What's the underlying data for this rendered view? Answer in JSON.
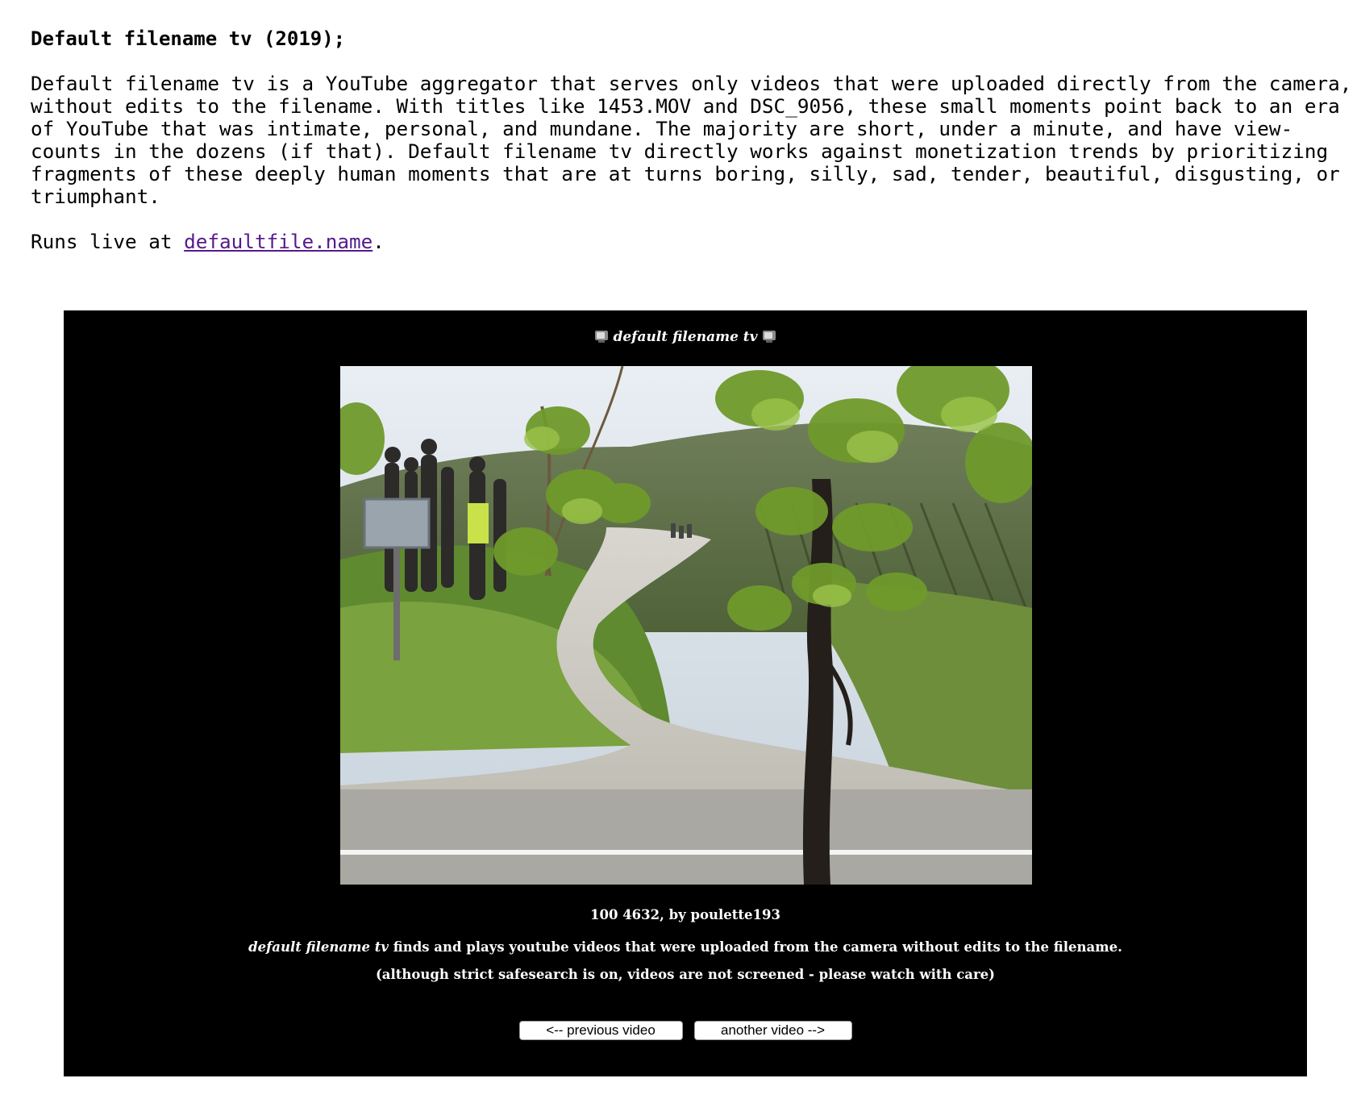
{
  "article": {
    "heading": "Default filename tv (2019);",
    "description_lines": [
      "Default filename tv is a YouTube aggregator that serves only videos that were uploaded directly from the camera,",
      "without edits to the filename. With titles like 1453.MOV and DSC_9056, these small moments point back to an era",
      "of YouTube that was intimate, personal, and mundane. The majority are short, under a minute, and have view-",
      "counts in the dozens (if that). Default filename tv directly works against monetization trends by prioritizing",
      "fragments of these deeply human moments that are at turns boring, silly, sad, tender, beautiful, disgusting, or",
      "triumphant."
    ],
    "runs_prefix": "Runs live at ",
    "runs_link_text": "defaultfile.name",
    "runs_suffix": "."
  },
  "embed": {
    "title": "default filename tv",
    "title_icon": "tv-icon",
    "video": {
      "scene": "vineyard road with spectators and grapevine in foreground"
    },
    "caption": "100 4632, by poulette193",
    "about_emphasis": "default filename tv",
    "about_rest": " finds and plays youtube videos that were uploaded from the camera without edits to the filename.",
    "warning": "(although strict safesearch is on, videos are not screened - please watch with care)",
    "prev_button": "<-- previous video",
    "next_button": "another video -->"
  },
  "colors": {
    "page_background": "#ffffff",
    "embed_background": "#000000",
    "embed_text": "#ffffff",
    "link": "#551a8b"
  }
}
